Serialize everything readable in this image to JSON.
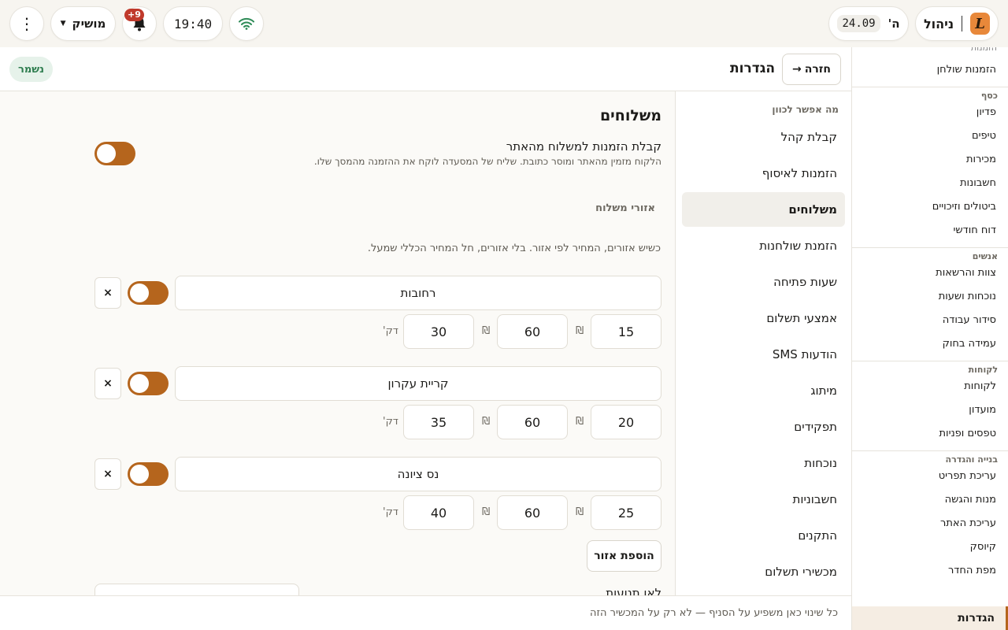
{
  "topbar": {
    "manage_label": "ניהול",
    "logo_glyph": "L",
    "day": "ה'",
    "date": "24.09",
    "time": "19:40",
    "notifications_badge": "9+",
    "user_name": "מושיק",
    "icons": [
      "logo-icon",
      "wifi-icon",
      "bell-icon",
      "chevron-down-icon",
      "more-vertical-icon"
    ]
  },
  "sidebar": {
    "top_partial": "הזמנות",
    "top_item": "הזמנות שולחן",
    "sections": [
      {
        "label": "כסף",
        "items": [
          "פדיון",
          "טיפים",
          "מכירות",
          "חשבונות",
          "ביטולים וזיכויים",
          "דוח חודשי"
        ]
      },
      {
        "label": "אנשים",
        "items": [
          "צוות והרשאות",
          "נוכחות ושעות",
          "סידור עבודה",
          "עמידה בחוק"
        ]
      },
      {
        "label": "לקוחות",
        "items": [
          "לקוחות",
          "מועדון",
          "טפסים ופניות"
        ]
      },
      {
        "label": "בנייה והגדרה",
        "items": [
          "עריכת תפריט",
          "מנות והגשה",
          "עריכת האתר",
          "קיוסק",
          "מפת החדר"
        ]
      }
    ],
    "active": "הגדרות",
    "accent": "#b5651d"
  },
  "header": {
    "back_label": "חזרה",
    "back_arrow": "→",
    "title": "הגדרות",
    "saved_label": "נשמר"
  },
  "subnav": {
    "label": "מה אפשר לכוון",
    "items": [
      "קבלת קהל",
      "הזמנות לאיסוף",
      "משלוחים",
      "הזמנת שולחנות",
      "שעות פתיחה",
      "אמצעי תשלום",
      "הודעות SMS",
      "מיתוג",
      "תפקידים",
      "נוכחות",
      "חשבוניות",
      "התקנים",
      "מכשירי תשלום"
    ],
    "active_index": 2
  },
  "delivery": {
    "title": "משלוחים",
    "online_title": "קבלת הזמנות למשלוח מהאתר",
    "online_desc": "הלקוח מזמין מהאתר ומוסר כתובת. שליח של המסעדה לוקח את ההזמנה מהמסך שלו.",
    "online_enabled": true,
    "zones_heading": "אזורי משלוח",
    "zones_hint": "כשיש אזורים, המחיר לפי אזור. בלי אזורים, חל המחיר הכללי שמעל.",
    "currency": "₪",
    "minutes_unit": "דק'",
    "delete_glyph": "×",
    "zones": [
      {
        "name": "רחובות",
        "enabled": true,
        "fee": "15",
        "min_order": "60",
        "minutes": "30"
      },
      {
        "name": "קריית עקרון",
        "enabled": true,
        "fee": "20",
        "min_order": "60",
        "minutes": "35"
      },
      {
        "name": "נס ציונה",
        "enabled": true,
        "fee": "25",
        "min_order": "60",
        "minutes": "40"
      }
    ],
    "add_zone_label": "הוספת אזור",
    "next_row_partial": "לאן תנועות"
  },
  "footer": {
    "text": "כל שינוי כאן משפיע על הסניף — לא רק על המכשיר הזה"
  }
}
